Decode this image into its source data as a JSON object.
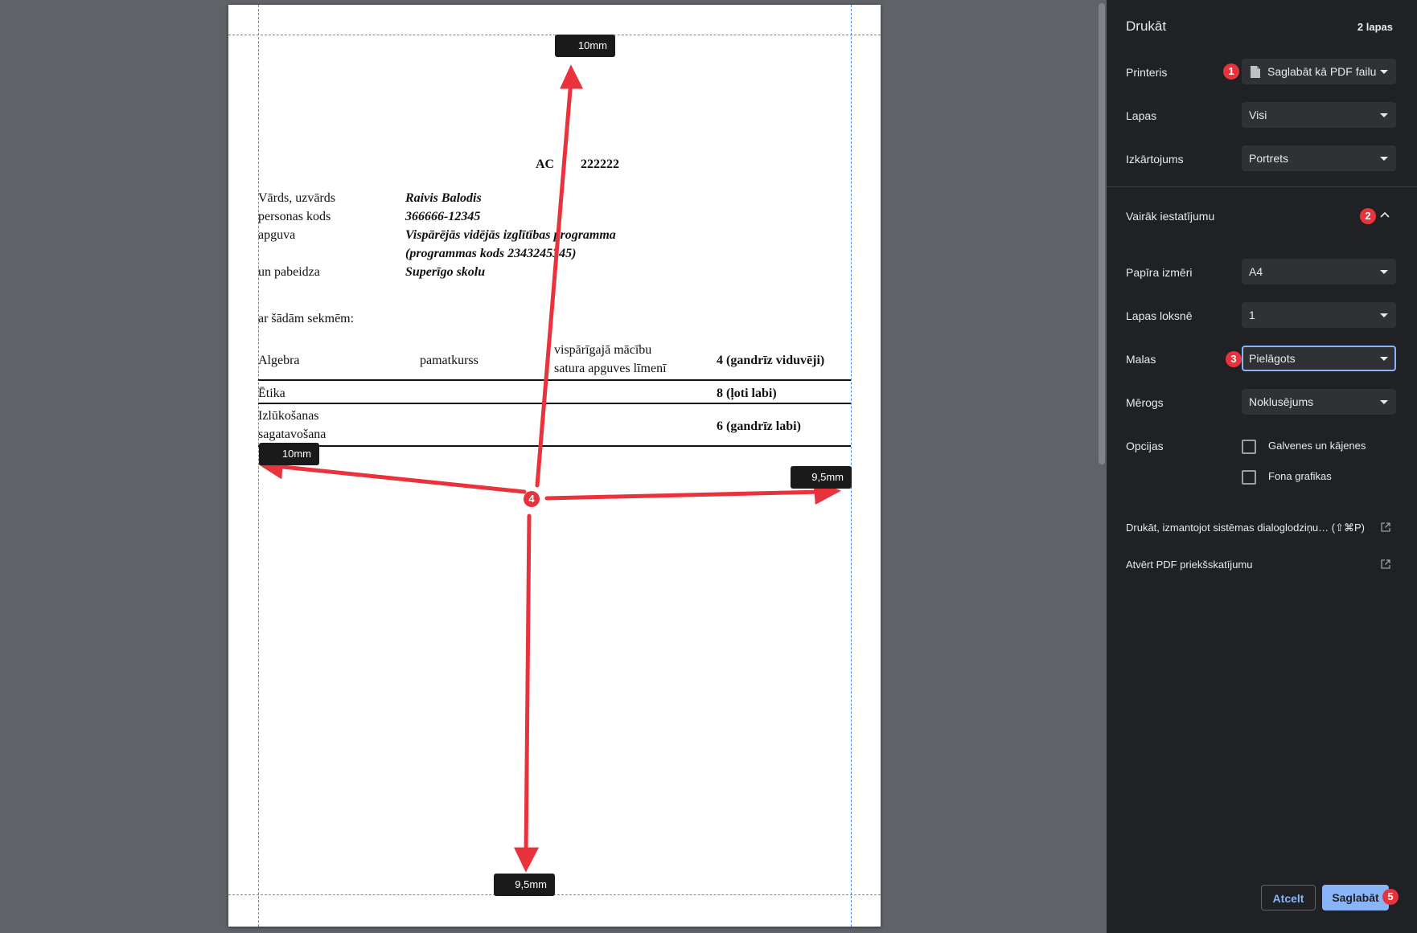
{
  "preview": {
    "document": {
      "heading_left": "AC",
      "heading_right": "222222",
      "fields": [
        {
          "label": "Vārds, uzvārds",
          "value": "Raivis Balodis"
        },
        {
          "label": "personas kods",
          "value": "366666-12345"
        },
        {
          "label": "apguva",
          "value": "Vispārējās vidējās izglītības programma"
        },
        {
          "label": "",
          "value": "(programmas kods 2343245345)"
        },
        {
          "label": "un pabeidza",
          "value": "Superīgo skolu"
        }
      ],
      "intro": "ar šādām sekmēm:",
      "rows": [
        {
          "subject": "Algebra",
          "level": "pamatkurss",
          "scope_line1": "vispārīgajā mācību",
          "scope_line2": "satura apguves līmenī",
          "grade": "4 (gandrīz viduvēji)"
        },
        {
          "subject": "Ētika",
          "level": "",
          "scope_line1": "",
          "scope_line2": "",
          "grade": "8 (ļoti labi)"
        },
        {
          "subject_line1": "Izlūkošanas",
          "subject_line2": "sagatavošana",
          "grade": "6 (gandrīz labi)"
        }
      ]
    },
    "margin_labels": {
      "top": "10mm",
      "left": "10mm",
      "right": "9,5mm",
      "bottom": "9,5mm"
    },
    "callouts": {
      "center": "4"
    }
  },
  "panel": {
    "title": "Drukāt",
    "page_count": "2 lapas",
    "printer": {
      "label": "Printeris",
      "value": "Saglabāt kā PDF failu",
      "badge": "1"
    },
    "pages": {
      "label": "Lapas",
      "value": "Visi"
    },
    "layout": {
      "label": "Izkārtojums",
      "value": "Portrets"
    },
    "more_settings": {
      "label": "Vairāk iestatījumu",
      "badge": "2"
    },
    "paper_size": {
      "label": "Papīra izmēri",
      "value": "A4"
    },
    "pages_per_sheet": {
      "label": "Lapas loksnē",
      "value": "1"
    },
    "margins": {
      "label": "Malas",
      "value": "Pielāgots",
      "badge": "3"
    },
    "scale": {
      "label": "Mērogs",
      "value": "Noklusējums"
    },
    "options": {
      "label": "Opcijas",
      "headers_footers": "Galvenes un kājenes",
      "background_graphics": "Fona grafikas"
    },
    "system_dialog_link": "Drukāt, izmantojot sistēmas dialoglodziņu… (⇧⌘P)",
    "open_pdf_link": "Atvērt PDF priekšskatījumu",
    "cancel_label": "Atcelt",
    "save_label": "Saglabāt",
    "save_badge": "5"
  },
  "colors": {
    "accent": "#8ab4f8",
    "callout": "#e8323c",
    "panel_bg": "#202124",
    "preview_bg": "#5f6368"
  }
}
